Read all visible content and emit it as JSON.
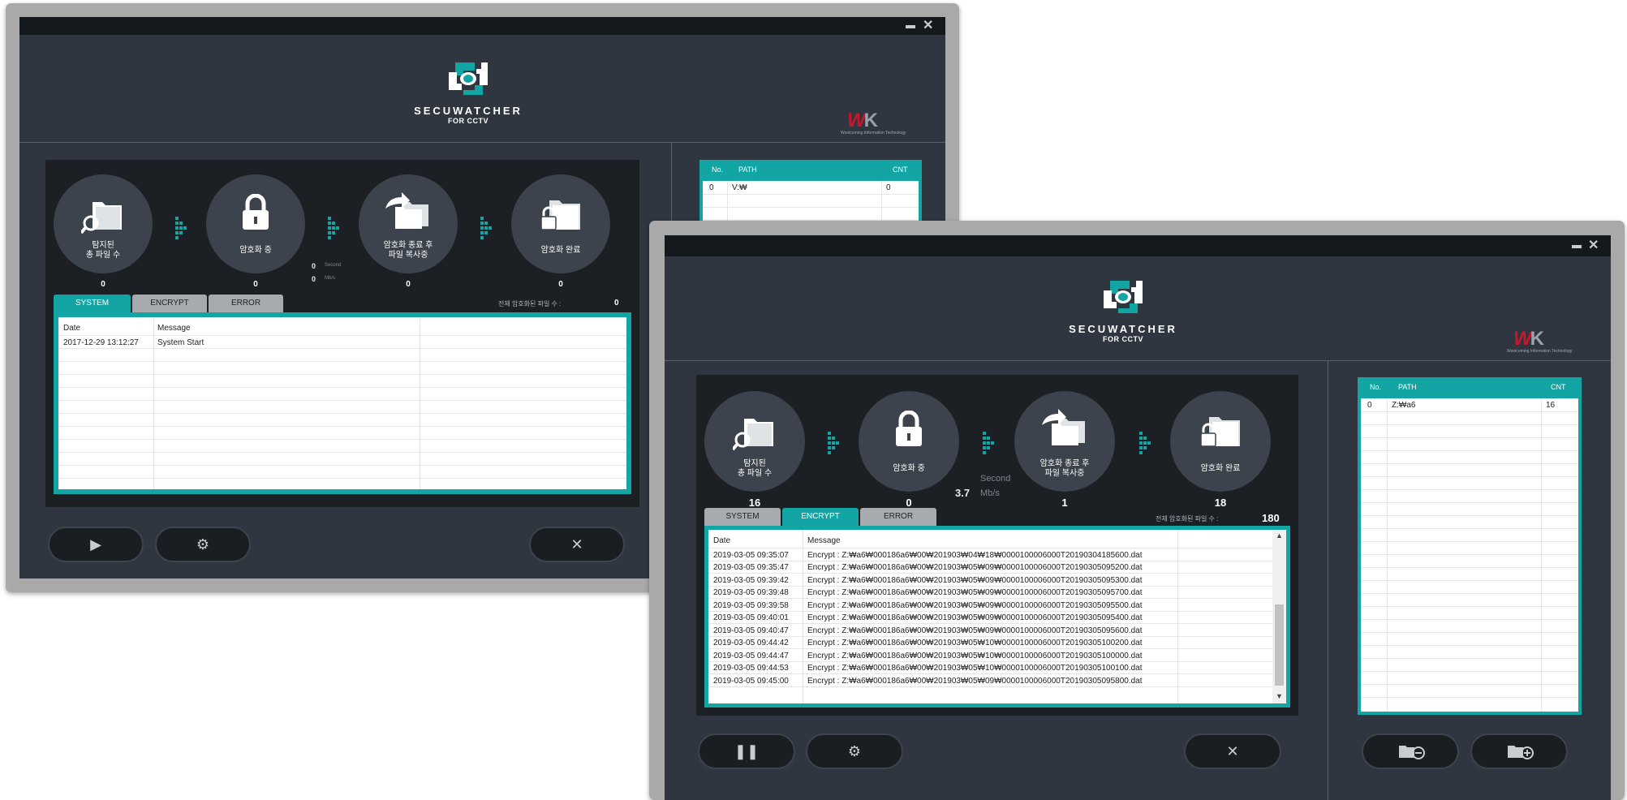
{
  "colors": {
    "accent": "#12a5a3",
    "panel": "#1c1f24",
    "window": "#2f3640",
    "brand_red": "#c8172c"
  },
  "icons": [
    "minimize-icon",
    "close-icon",
    "search-folder-icon",
    "lock-icon",
    "copy-folders-icon",
    "lock-folder-icon",
    "play-icon",
    "pause-icon",
    "gear-icon",
    "x-icon",
    "folder-minus-icon",
    "folder-plus-icon"
  ],
  "win1": {
    "logo_name": "SECUWATCHER",
    "logo_sub": "FOR CCTV",
    "brand": {
      "w": "W",
      "k": "K",
      "sub": "Woolcoming Information Technology"
    },
    "steps": [
      {
        "label": "탐지된\n총 파일 수",
        "count": "0"
      },
      {
        "label": "암호화 중",
        "count": "0"
      },
      {
        "label": "암호화 종료 후\n파일 복사중",
        "count": "0"
      },
      {
        "label": "암호화 완료",
        "count": "0"
      }
    ],
    "speed": {
      "seconds": "0",
      "seconds_unit": "Second",
      "rate": "0",
      "rate_unit": "Mb/s"
    },
    "tabs": [
      "SYSTEM",
      "ENCRYPT",
      "ERROR"
    ],
    "total_label": "전체 암호화된 파일 수  :",
    "total_value": "0",
    "log_headers": [
      "Date",
      "Message"
    ],
    "log_rows": [
      {
        "date": "2017-12-29 13:12:27",
        "message": "System Start"
      }
    ],
    "path_headers": [
      "No.",
      "PATH",
      "CNT"
    ],
    "path_rows": [
      {
        "no": "0",
        "path": "V:₩",
        "cnt": "0"
      }
    ]
  },
  "win2": {
    "logo_name": "SECUWATCHER",
    "logo_sub": "FOR CCTV",
    "brand": {
      "w": "W",
      "k": "K",
      "sub": "Woolcoming Information Technology"
    },
    "steps": [
      {
        "label": "탐지된\n총 파일 수",
        "count": "16"
      },
      {
        "label": "암호화 중",
        "count": "0"
      },
      {
        "label": "암호화 종료 후\n파일 복사중",
        "count": "1"
      },
      {
        "label": "암호화 완료",
        "count": "18"
      }
    ],
    "speed": {
      "seconds": "",
      "seconds_unit": "Second",
      "rate": "3.7",
      "rate_unit": "Mb/s"
    },
    "tabs": [
      "SYSTEM",
      "ENCRYPT",
      "ERROR"
    ],
    "total_label": "전체 암호화된 파일 수  :",
    "total_value": "180",
    "log_headers": [
      "Date",
      "Message"
    ],
    "log_rows": [
      {
        "date": "2019-03-05 09:35:07",
        "message": "Encrypt : Z:₩a6₩000186a6₩00₩201903₩04₩18₩0000100006000T20190304185600.dat"
      },
      {
        "date": "2019-03-05 09:35:47",
        "message": "Encrypt : Z:₩a6₩000186a6₩00₩201903₩05₩09₩0000100006000T20190305095200.dat"
      },
      {
        "date": "2019-03-05 09:39:42",
        "message": "Encrypt : Z:₩a6₩000186a6₩00₩201903₩05₩09₩0000100006000T20190305095300.dat"
      },
      {
        "date": "2019-03-05 09:39:48",
        "message": "Encrypt : Z:₩a6₩000186a6₩00₩201903₩05₩09₩0000100006000T20190305095700.dat"
      },
      {
        "date": "2019-03-05 09:39:58",
        "message": "Encrypt : Z:₩a6₩000186a6₩00₩201903₩05₩09₩0000100006000T20190305095500.dat"
      },
      {
        "date": "2019-03-05 09:40:01",
        "message": "Encrypt : Z:₩a6₩000186a6₩00₩201903₩05₩09₩0000100006000T20190305095400.dat"
      },
      {
        "date": "2019-03-05 09:40:47",
        "message": "Encrypt : Z:₩a6₩000186a6₩00₩201903₩05₩09₩0000100006000T20190305095600.dat"
      },
      {
        "date": "2019-03-05 09:44:42",
        "message": "Encrypt : Z:₩a6₩000186a6₩00₩201903₩05₩10₩0000100006000T20190305100200.dat"
      },
      {
        "date": "2019-03-05 09:44:47",
        "message": "Encrypt : Z:₩a6₩000186a6₩00₩201903₩05₩10₩0000100006000T20190305100000.dat"
      },
      {
        "date": "2019-03-05 09:44:53",
        "message": "Encrypt : Z:₩a6₩000186a6₩00₩201903₩05₩10₩0000100006000T20190305100100.dat"
      },
      {
        "date": "2019-03-05 09:45:00",
        "message": "Encrypt : Z:₩a6₩000186a6₩00₩201903₩05₩09₩0000100006000T20190305095800.dat"
      }
    ],
    "path_headers": [
      "No.",
      "PATH",
      "CNT"
    ],
    "path_rows": [
      {
        "no": "0",
        "path": "Z:₩a6",
        "cnt": "16"
      }
    ]
  }
}
